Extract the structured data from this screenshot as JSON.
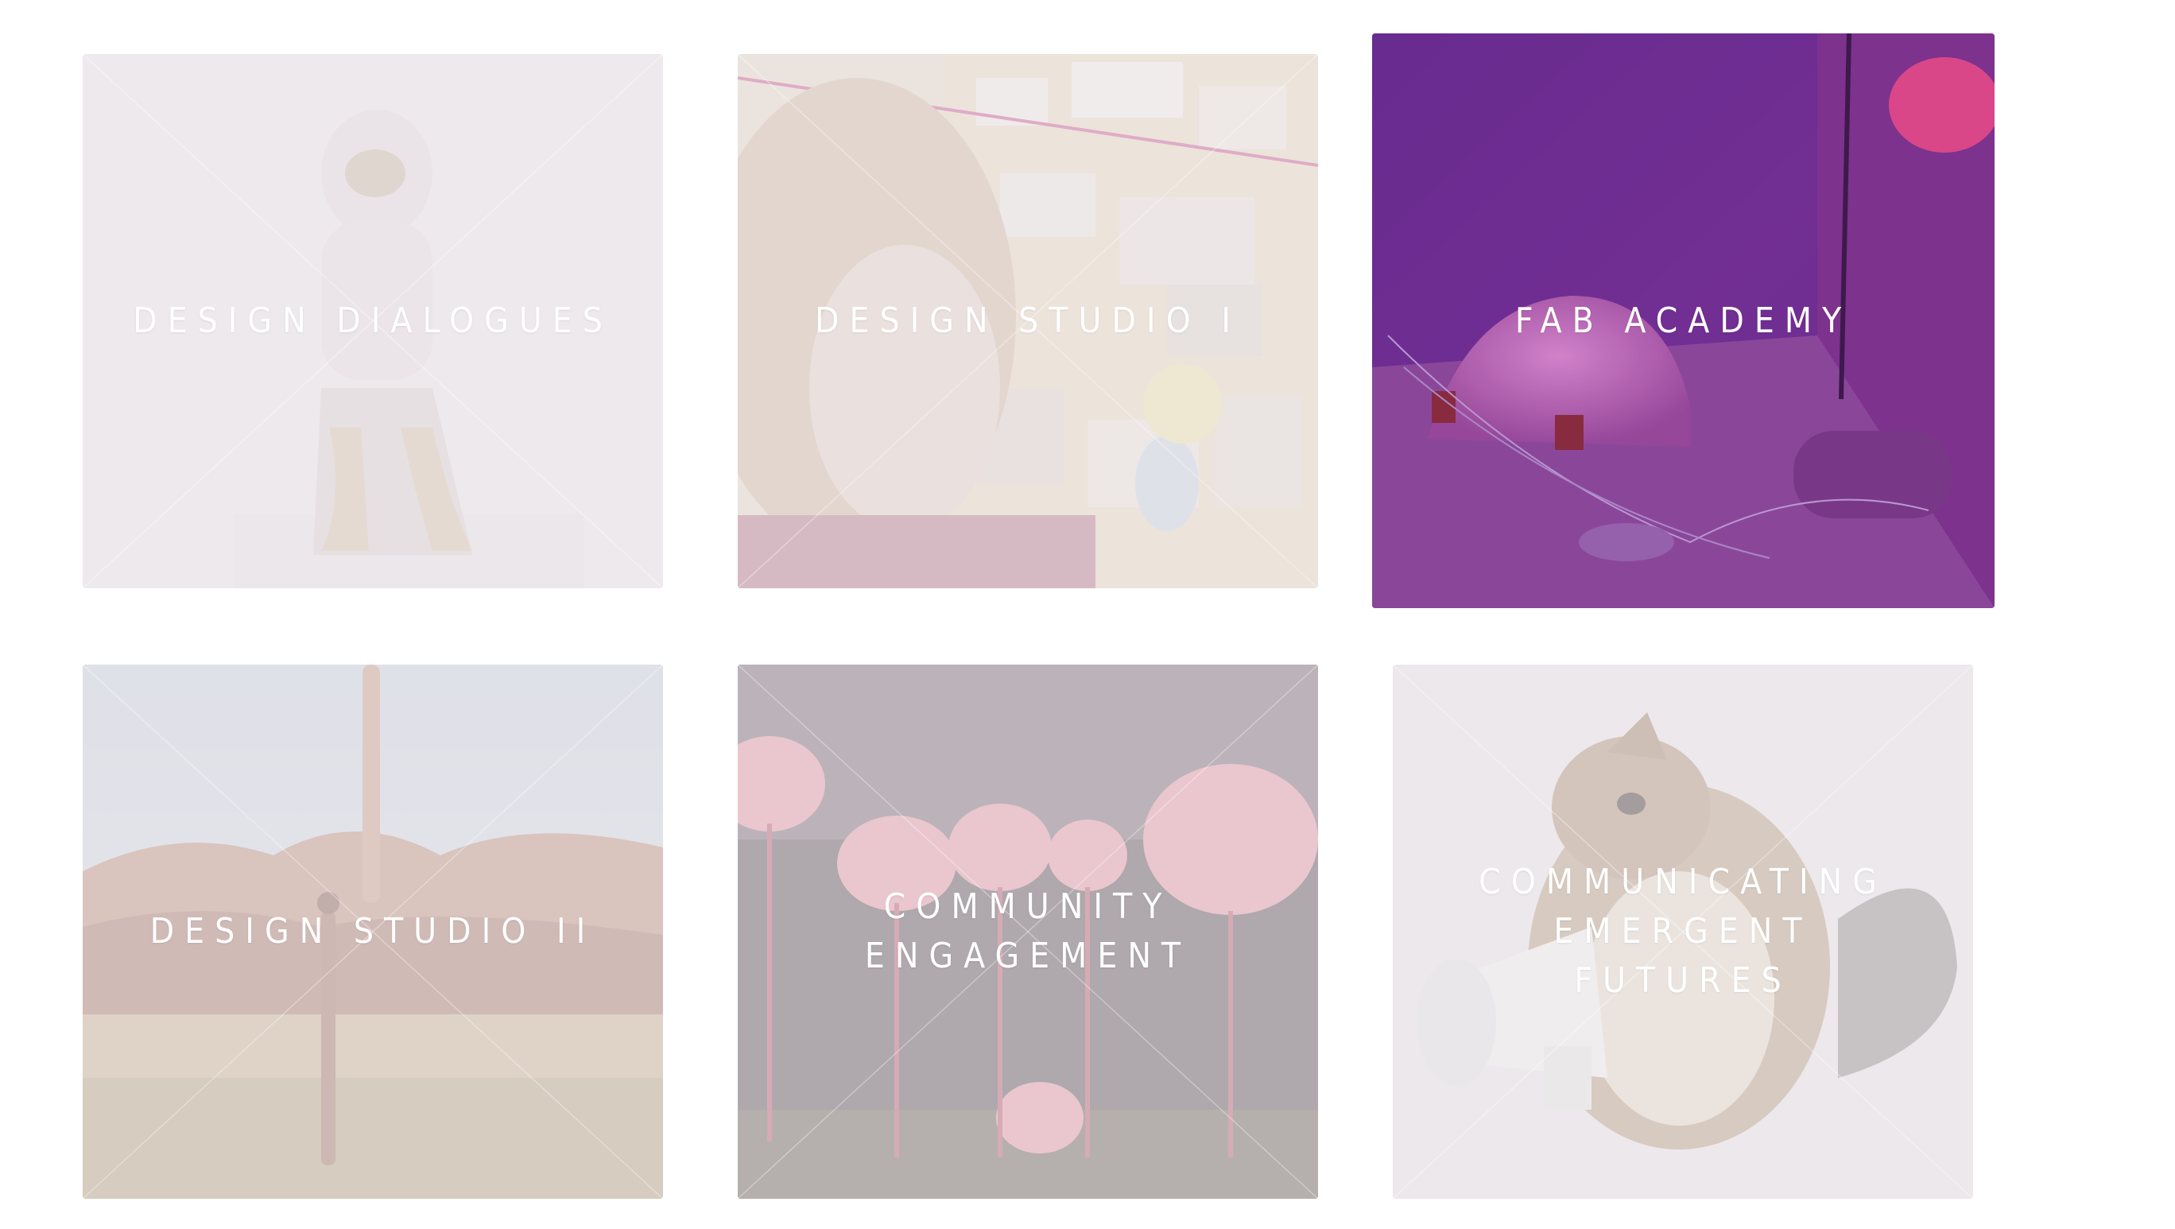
{
  "courses": [
    {
      "title": "DESIGN DIALOGUES",
      "image": "astronaut-figure-image"
    },
    {
      "title": "DESIGN STUDIO I",
      "image": "moodboard-person-image"
    },
    {
      "title": "FAB ACADEMY",
      "image": "purple-grow-tent-image"
    },
    {
      "title": "DESIGN STUDIO II",
      "image": "desert-figures-image"
    },
    {
      "title": "COMMUNITY ENGAGEMENT",
      "image": "pink-mushrooms-image"
    },
    {
      "title": "COMMUNICATING EMERGENT FUTURES",
      "image": "chipmunk-megaphone-image"
    }
  ],
  "colors": {
    "page_background": "#ffffff",
    "label_text": "#ffffff",
    "veil": "#eee8ec",
    "fab_academy_accent": "#7a2a8a"
  }
}
